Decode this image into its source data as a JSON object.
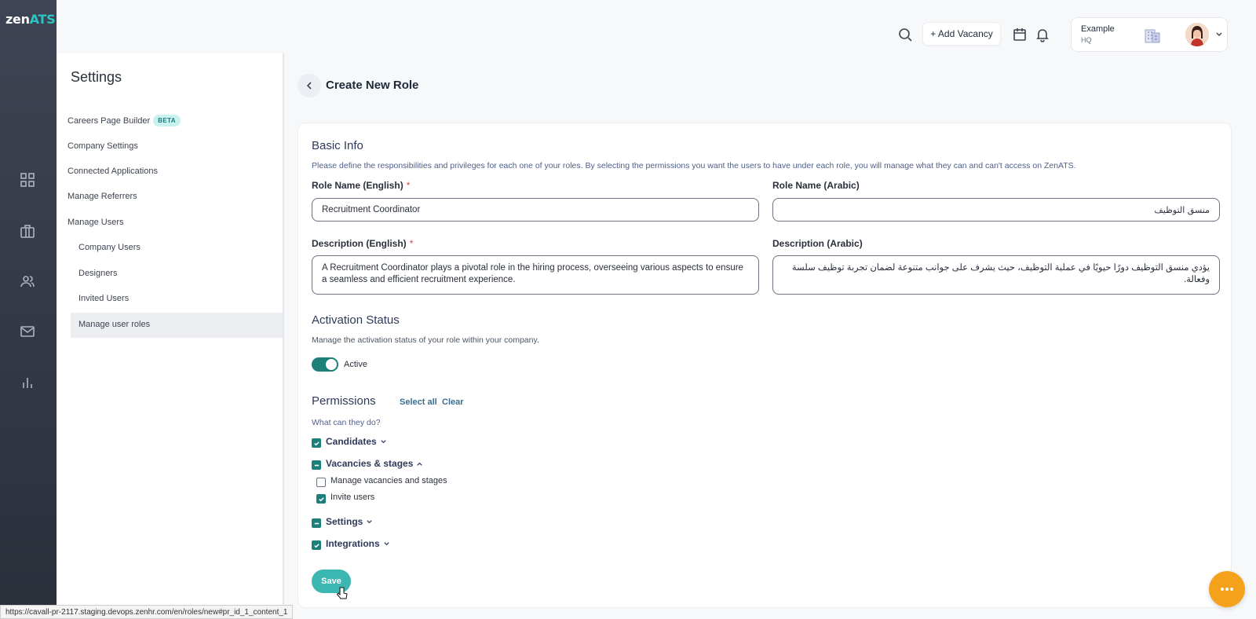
{
  "brand": {
    "zen": "zen",
    "ats": "ATS"
  },
  "rail": {
    "icons": [
      "grid-icon",
      "briefcase-icon",
      "users-icon",
      "mail-icon",
      "bar-chart-icon"
    ]
  },
  "settings": {
    "title": "Settings",
    "items": [
      {
        "label": "Careers Page Builder",
        "badge": "BETA"
      },
      {
        "label": "Company Settings"
      },
      {
        "label": "Connected Applications"
      },
      {
        "label": "Manage Referrers"
      },
      {
        "label": "Manage Users"
      },
      {
        "label": "Company Users"
      },
      {
        "label": "Designers"
      },
      {
        "label": "Invited Users"
      },
      {
        "label": "Manage user roles"
      }
    ]
  },
  "topbar": {
    "add_vacancy": "+ Add Vacancy",
    "company_name": "Example",
    "company_sub": "HQ"
  },
  "page": {
    "title": "Create New Role"
  },
  "basic_info": {
    "title": "Basic Info",
    "description": "Please define the responsibilities and privileges for each one of your roles. By selecting the permissions you want the users to have under each role, you will manage what they can and can't access on ZenATS.",
    "role_name_en_label": "Role Name (English)",
    "role_name_en_value": "Recruitment Coordinator",
    "role_name_ar_label": "Role Name (Arabic)",
    "role_name_ar_value": "منسق التوظيف",
    "desc_en_label": "Description (English)",
    "desc_en_value": "A Recruitment Coordinator plays a pivotal role in the hiring process, overseeing various aspects to ensure a seamless and efficient recruitment experience.",
    "desc_ar_label": "Description (Arabic)",
    "desc_ar_value": "يؤدي منسق التوظيف دورًا حيويًا في عملية التوظيف، حيث يشرف على جوانب متنوعة لضمان تجربة توظيف سلسة وفعالة.",
    "required_mark": "*"
  },
  "activation": {
    "title": "Activation Status",
    "description": "Manage the activation status of your role within your company.",
    "toggle_label": "Active",
    "active": true
  },
  "permissions": {
    "title": "Permissions",
    "select_all": "Select all",
    "clear": "Clear",
    "subtitle": "What can they do?",
    "groups": [
      {
        "label": "Candidates",
        "state": "checked",
        "expanded": false
      },
      {
        "label": "Vacancies & stages",
        "state": "partial",
        "expanded": true,
        "children": [
          {
            "label": "Manage vacancies and stages",
            "checked": false
          },
          {
            "label": "Invite users",
            "checked": true
          }
        ]
      },
      {
        "label": "Settings",
        "state": "partial",
        "expanded": false
      },
      {
        "label": "Integrations",
        "state": "checked",
        "expanded": false
      }
    ]
  },
  "actions": {
    "save": "Save"
  },
  "status_bar": {
    "url": "https://cavall-pr-2117.staging.devops.zenhr.com/en/roles/new#pr_id_1_content_1"
  },
  "colors": {
    "accent": "#1d7f7a",
    "save": "#3bb6b0",
    "fab": "#f4a21b",
    "rail": "#2b2f3a"
  }
}
